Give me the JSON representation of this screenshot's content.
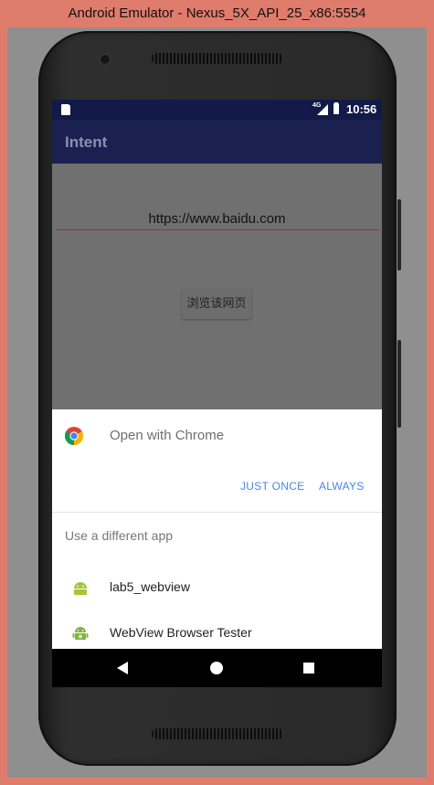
{
  "window": {
    "title": "Android Emulator - Nexus_5X_API_25_x86:5554"
  },
  "status_bar": {
    "time": "10:56",
    "network": "4G"
  },
  "app_bar": {
    "title": "Intent"
  },
  "url_field": {
    "value": "https://www.baidu.com"
  },
  "browse_button": {
    "label": "浏览该网页"
  },
  "chooser": {
    "open_with": "Open with Chrome",
    "just_once": "JUST ONCE",
    "always": "ALWAYS",
    "use_different": "Use a different app",
    "apps": [
      {
        "label": "lab5_webview",
        "icon": "android-icon"
      },
      {
        "label": "WebView Browser Tester",
        "icon": "android-tester-icon"
      }
    ]
  },
  "colors": {
    "status_bar": "#121a4a",
    "app_bar": "#1a2150",
    "accent": "#4a87e0",
    "underline": "#a52a4a",
    "android_green": "#a4c639"
  }
}
